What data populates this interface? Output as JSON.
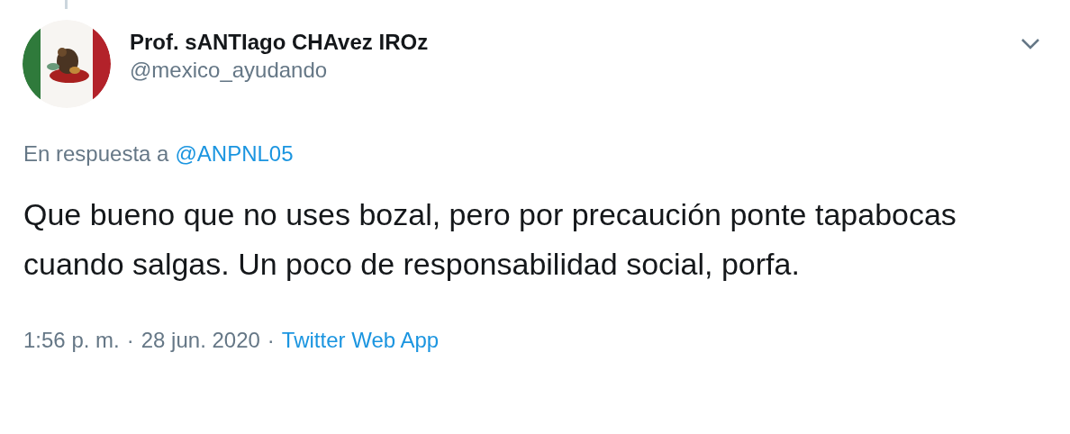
{
  "tweet": {
    "display_name": "Prof. sANTIago CHAvez IROz",
    "handle": "@mexico_ayudando",
    "reply_to": {
      "prefix": "En respuesta a",
      "mention": "@ANPNL05"
    },
    "text": "Que bueno que no uses bozal, pero por precaución ponte tapabocas cuando salgas. Un poco de responsabilidad social, porfa.",
    "footer": {
      "time": "1:56 p. m.",
      "separator_1": "·",
      "date": "28 jun. 2020",
      "separator_2": "·",
      "source": "Twitter Web App"
    }
  }
}
